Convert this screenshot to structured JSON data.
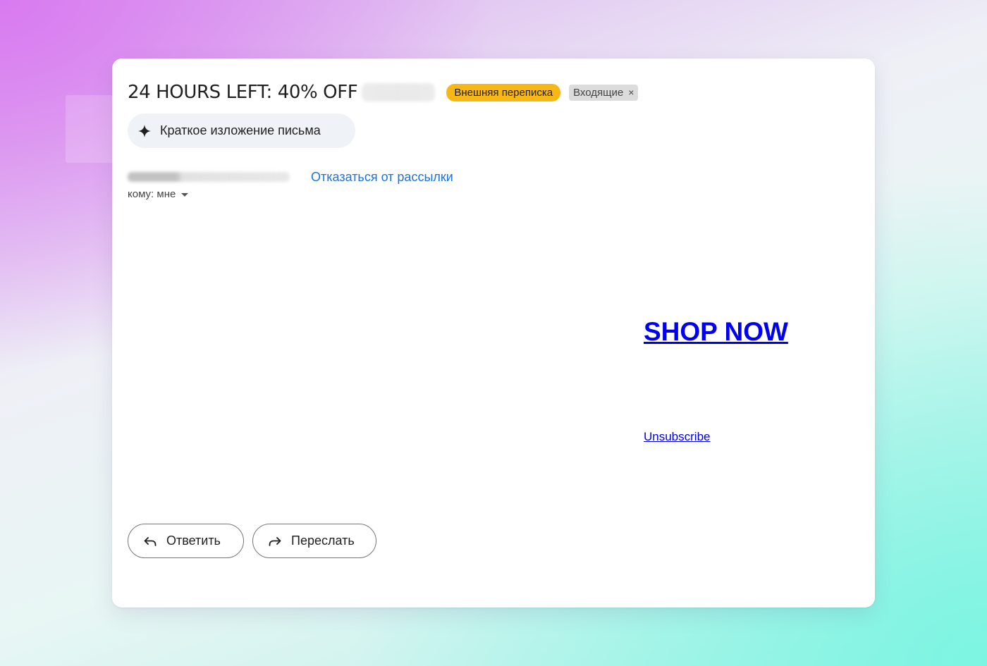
{
  "email": {
    "subject": "24 HOURS LEFT: 40% OFF",
    "labels": {
      "external": "Внешняя переписка",
      "inbox": "Входящие",
      "inbox_remove_icon": "×"
    },
    "summary_button": "Краткое изложение письма",
    "unsubscribe_header_link": "Отказаться от рассылки",
    "to_line": "кому: мне",
    "body": {
      "shop_now": "SHOP NOW",
      "unsubscribe": "Unsubscribe"
    },
    "actions": {
      "reply": "Ответить",
      "forward": "Переслать"
    }
  },
  "colors": {
    "external_label_bg": "#f7b717",
    "inbox_label_bg": "#dcdcdc",
    "link_blue": "#1a73e8",
    "body_link": "#0000ee",
    "summary_bg": "#eff3f8"
  },
  "icons": {
    "summary": "sparkle-icon",
    "reply": "reply-arrow-icon",
    "forward": "forward-arrow-icon",
    "to_dropdown": "caret-down-icon",
    "label_remove": "close-icon"
  }
}
